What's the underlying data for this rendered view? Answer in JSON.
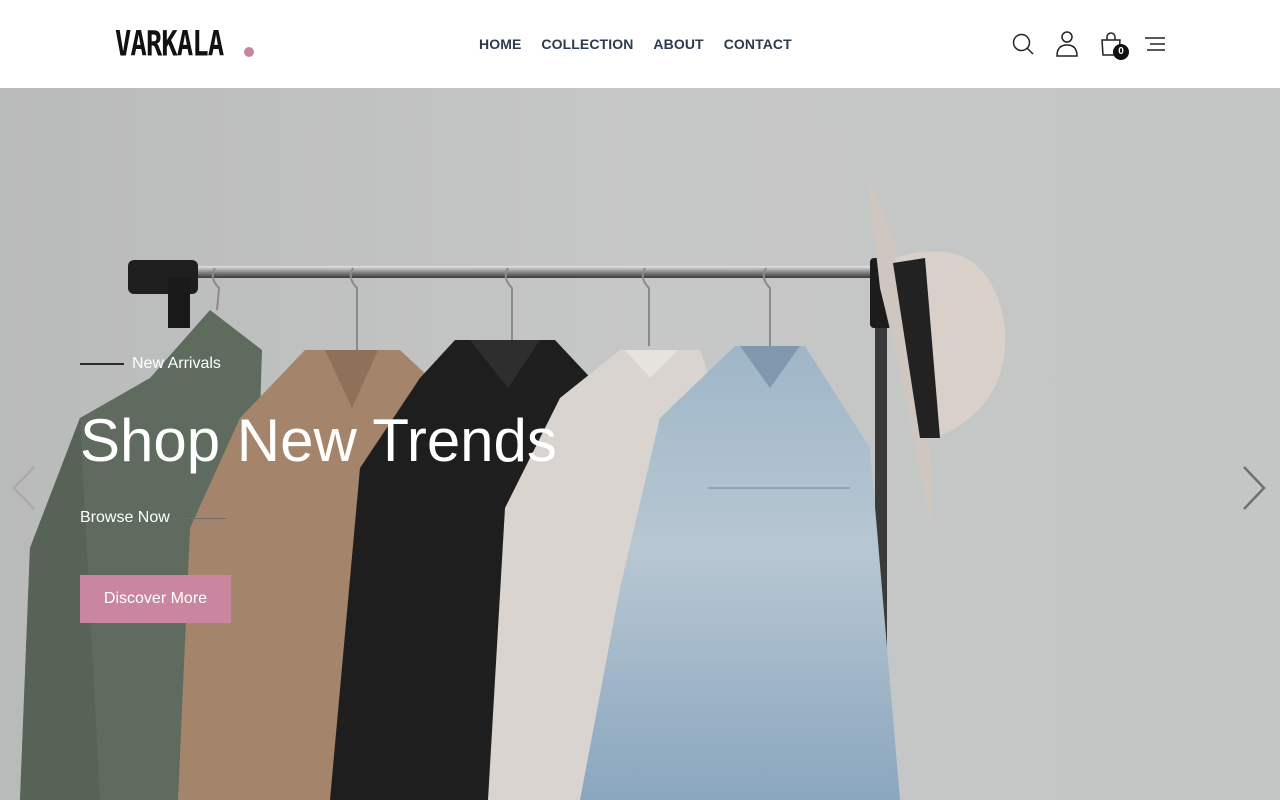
{
  "brand": {
    "name": "VARKALA",
    "accent_color": "#c6869e"
  },
  "nav": {
    "items": [
      {
        "label": "HOME"
      },
      {
        "label": "COLLECTION"
      },
      {
        "label": "ABOUT"
      },
      {
        "label": "CONTACT"
      }
    ]
  },
  "header_icons": {
    "search": "search-icon",
    "account": "user-icon",
    "cart": "shopping-bag-icon",
    "cart_count": "0",
    "menu": "hamburger-menu-icon"
  },
  "hero": {
    "subtitle": "New Arrivals",
    "title": "Shop New Trends",
    "browse_label": "Browse Now",
    "cta_label": "Discover More",
    "cta_color": "#c9879f",
    "prev_icon": "chevron-left-icon",
    "next_icon": "chevron-right-icon"
  }
}
